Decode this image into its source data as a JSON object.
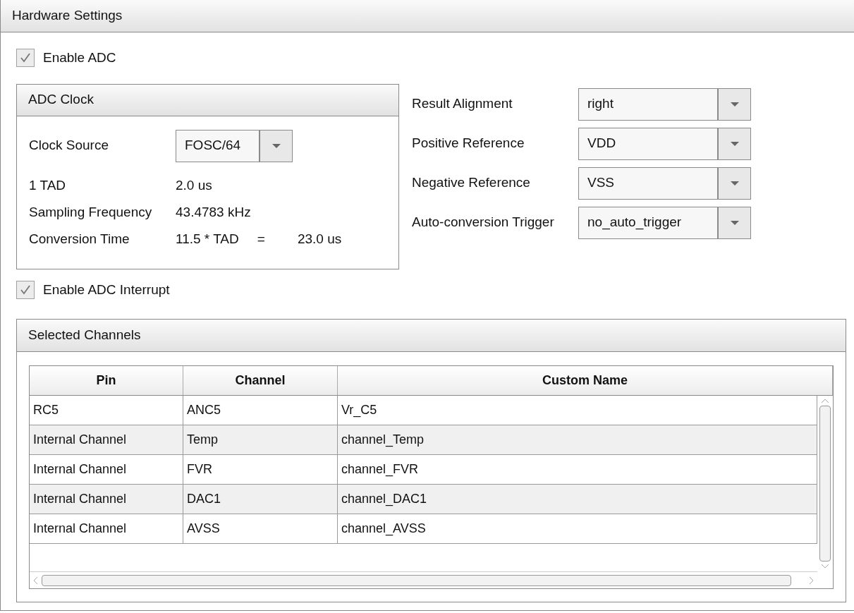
{
  "panel": {
    "title": "Hardware Settings"
  },
  "enable_adc": {
    "label": "Enable ADC",
    "checked": true
  },
  "adc_clock": {
    "title": "ADC Clock",
    "clock_source": {
      "label": "Clock Source",
      "value": "FOSC/64"
    },
    "rows": [
      {
        "label": "1 TAD",
        "value": "2.0 us"
      },
      {
        "label": "Sampling Frequency",
        "value": "43.4783 kHz"
      },
      {
        "label": "Conversion Time",
        "value": "11.5 * TAD",
        "operator": "=",
        "result": "23.0 us"
      }
    ]
  },
  "settings": [
    {
      "label": "Result Alignment",
      "value": "right"
    },
    {
      "label": "Positive Reference",
      "value": "VDD"
    },
    {
      "label": "Negative Reference",
      "value": "VSS"
    },
    {
      "label": "Auto-conversion Trigger",
      "value": "no_auto_trigger"
    }
  ],
  "enable_interrupt": {
    "label": "Enable ADC Interrupt",
    "checked": true
  },
  "channels": {
    "title": "Selected Channels",
    "columns": [
      "Pin",
      "Channel",
      "Custom Name"
    ],
    "rows": [
      [
        "RC5",
        "ANC5",
        "Vr_C5"
      ],
      [
        "Internal Channel",
        "Temp",
        "channel_Temp"
      ],
      [
        "Internal Channel",
        "FVR",
        "channel_FVR"
      ],
      [
        "Internal Channel",
        "DAC1",
        "channel_DAC1"
      ],
      [
        "Internal Channel",
        "AVSS",
        "channel_AVSS"
      ]
    ]
  }
}
